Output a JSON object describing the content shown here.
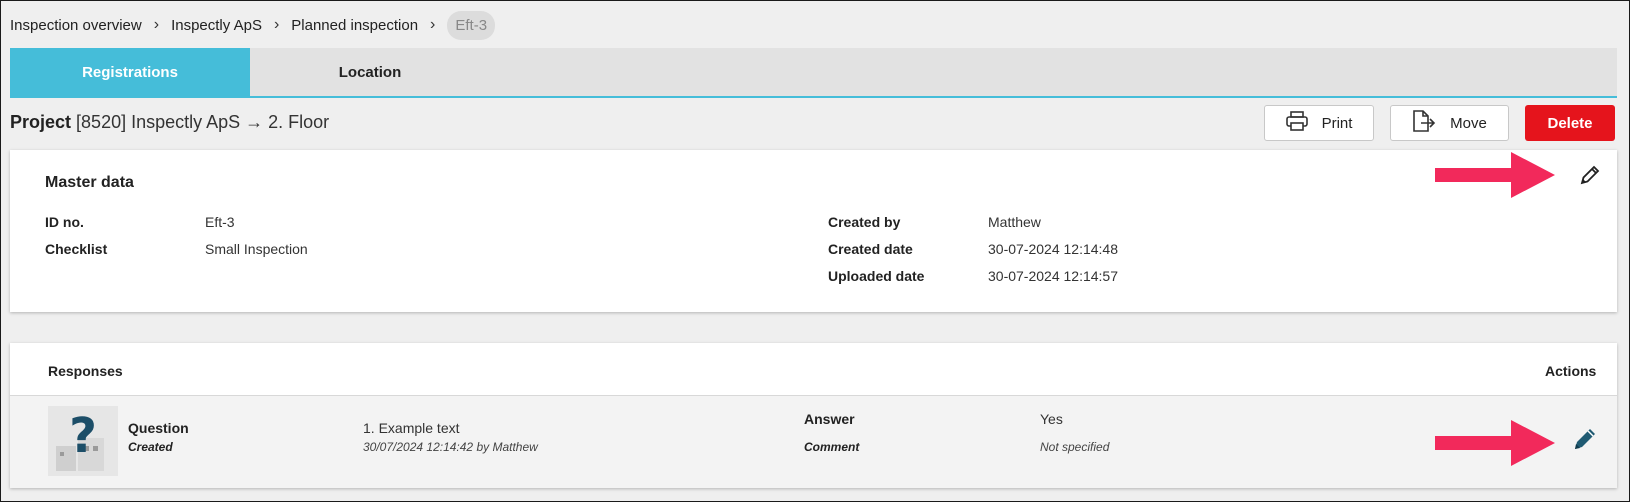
{
  "breadcrumb": {
    "items": [
      "Inspection overview",
      "Inspectly ApS",
      "Planned inspection"
    ],
    "current": "Eft-3"
  },
  "tabs": [
    {
      "label": "Registrations",
      "active": true
    },
    {
      "label": "Location",
      "active": false
    }
  ],
  "project": {
    "label": "Project",
    "path": "[8520] Inspectly ApS → 2. Floor"
  },
  "toolbar": {
    "print_label": "Print",
    "move_label": "Move",
    "delete_label": "Delete"
  },
  "master": {
    "title": "Master data",
    "left_fields": [
      {
        "label": "ID no.",
        "value": "Eft-3"
      },
      {
        "label": "Checklist",
        "value": "Small Inspection"
      }
    ],
    "right_fields": [
      {
        "label": "Created by",
        "value": "Matthew"
      },
      {
        "label": "Created date",
        "value": "30-07-2024 12:14:48"
      },
      {
        "label": "Uploaded date",
        "value": "30-07-2024 12:14:57"
      }
    ]
  },
  "responses": {
    "title": "Responses",
    "actions_title": "Actions",
    "row": {
      "question_label": "Question",
      "status": "Created",
      "question_text": "1. Example text",
      "timestamp": "30/07/2024 12:14:42 by Matthew",
      "answer_label": "Answer",
      "answer_value": "Yes",
      "comment_label": "Comment",
      "comment_value": "Not specified"
    }
  },
  "colors": {
    "accent": "#45bdd9",
    "delete": "#e5141c",
    "annotation_arrow": "#f2295b",
    "pencil_dark": "#1f5a72"
  }
}
